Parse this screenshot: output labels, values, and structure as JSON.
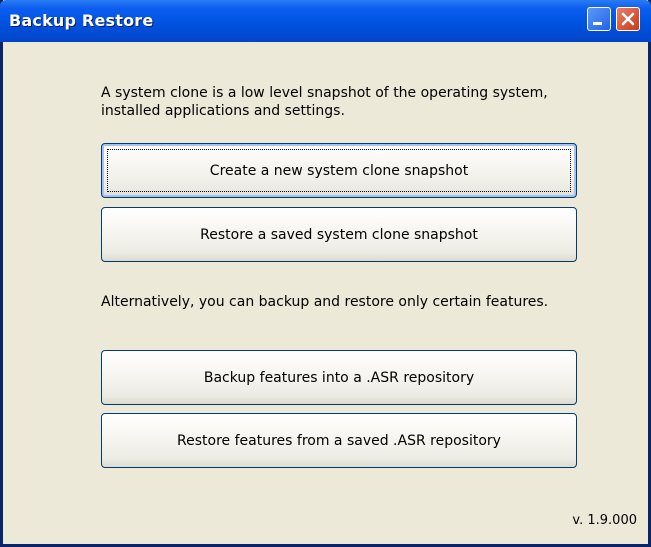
{
  "window": {
    "title": "Backup Restore"
  },
  "content": {
    "description_clone": "A system clone is a low level snapshot of the operating system, installed applications and settings.",
    "description_features": "Alternatively, you can backup and restore only certain features.",
    "version": "v. 1.9.000"
  },
  "buttons": {
    "create_clone": "Create a new system clone snapshot",
    "restore_clone": "Restore a saved system clone snapshot",
    "backup_features": "Backup features into a .ASR repository",
    "restore_features": "Restore features from a saved .ASR repository"
  },
  "icons": {
    "minimize": "minimize-icon",
    "close": "close-icon"
  },
  "colors": {
    "titlebar": "#0053e0",
    "window_bg": "#ece9d8",
    "close_button": "#c63b1a",
    "button_border": "#003c74"
  }
}
